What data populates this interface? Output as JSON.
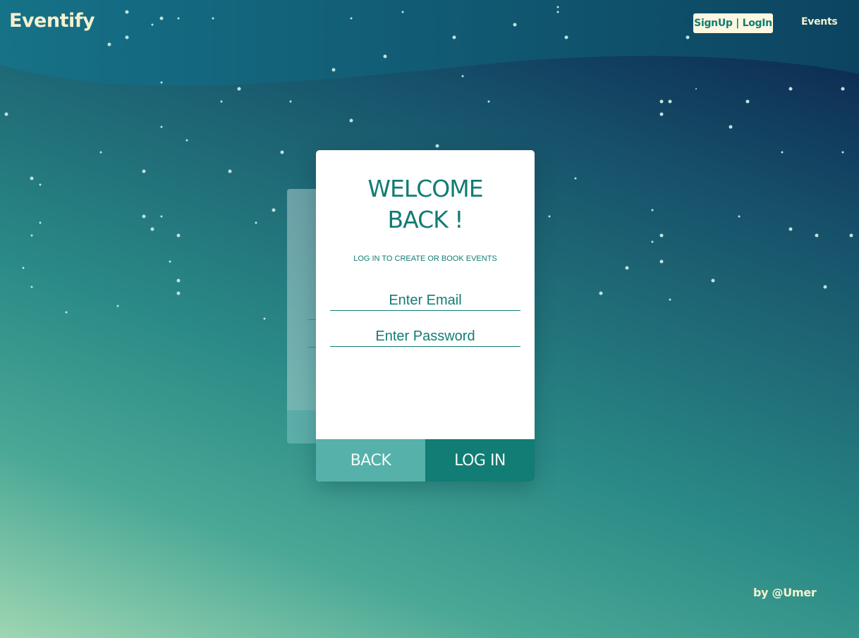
{
  "brand": {
    "logo": "Eventify"
  },
  "nav": {
    "auth_label": "SignUp | LogIn",
    "events_label": "Events"
  },
  "login_card": {
    "title_line1": "WELCOME",
    "title_line2": "BACK !",
    "subtitle": "LOG IN TO CREATE OR BOOK EVENTS",
    "email_placeholder": "Enter Email",
    "password_placeholder": "Enter Password",
    "back_label": "BACK",
    "login_label": "LOG IN"
  },
  "footer": {
    "credit": "by @Umer"
  },
  "colors": {
    "accent": "#117d74",
    "accent_light": "#55b1aa",
    "cream": "#f5f0d0"
  }
}
